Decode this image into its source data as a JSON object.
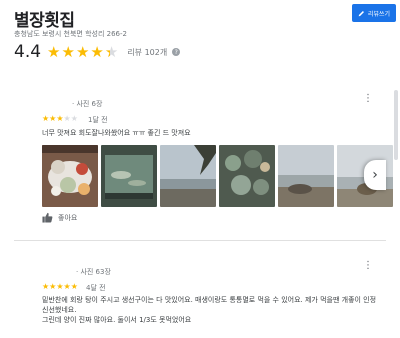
{
  "place": {
    "name": "별장횟집",
    "address": "충청남도 보령시 천북면 학성리 266-2",
    "rating": "4.4",
    "review_count": "리뷰 102개",
    "stars_filled": 4.4
  },
  "write_review_button": {
    "label": "리뷰쓰기"
  },
  "colors": {
    "star": "#fbbc04",
    "star_empty": "#dadce0",
    "accent": "#1a73e8"
  },
  "reviews": [
    {
      "reviewer_meta": "· 사진 6장",
      "stars": 3,
      "time": "1달 전",
      "text": "너무 맛져요   회도잘나와쐈어요   ㅠㅠ 좋긴 드   맛져요",
      "photos": [
        "seafood-platter-photo",
        "fish-tank-photo",
        "sea-view-photo",
        "shellfish-photo",
        "shore-rocks-photo",
        "beach-photo"
      ],
      "like_label": "좋아요"
    },
    {
      "reviewer_meta": "· 사진 63장",
      "stars": 5,
      "time": "4달 전",
      "text": "밑반찬에 회랑 탕이 주시고 생선구이는 다 맛있어요. 매생이랑도 통통멸로 먹을 수 있어요. 제가 먹을땐 개좋이 인정 신선했네요.\n그린데 양이 진짜 많아요. 둘이서 1/3도 못먹었어요"
    }
  ]
}
